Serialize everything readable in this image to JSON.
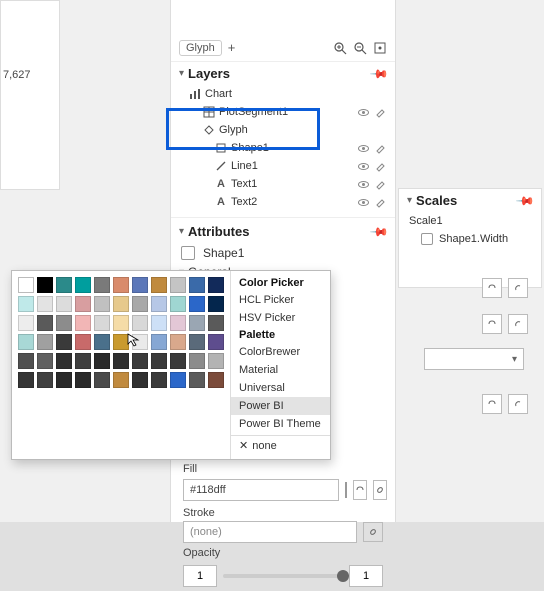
{
  "left_number": "7,627",
  "glyph_tab": "Glyph",
  "layers": {
    "title": "Layers",
    "items": [
      {
        "label": "Chart",
        "icon": "chart-icon"
      },
      {
        "label": "PlotSegment1",
        "icon": "grid-icon"
      },
      {
        "label": "Glyph",
        "icon": "glyph-icon"
      },
      {
        "label": "Shape1",
        "icon": "rect-icon"
      },
      {
        "label": "Line1",
        "icon": "line-icon"
      },
      {
        "label": "Text1",
        "icon": "text-icon"
      },
      {
        "label": "Text2",
        "icon": "text-icon"
      }
    ]
  },
  "attributes": {
    "title": "Attributes",
    "selected": "Shape1",
    "general": "General",
    "fill_label": "Fill",
    "fill_value": "#118dff",
    "fill_color": "#118dff",
    "stroke_label": "Stroke",
    "stroke_value": "(none)",
    "opacity_label": "Opacity",
    "opacity_low": "1",
    "opacity_high": "1"
  },
  "picker": {
    "head1": "Color Picker",
    "hcl": "HCL Picker",
    "hsv": "HSV Picker",
    "head2": "Palette",
    "items": [
      "ColorBrewer",
      "Material",
      "Universal",
      "Power BI",
      "Power BI Theme"
    ],
    "selected": "Power BI",
    "none": "none",
    "colors_row0": [
      "#ffffff",
      "#000000",
      "#2b8a8a",
      "#009e9e",
      "#7a7a7a",
      "#d98b6b",
      "#5b77b9",
      "#c08a3e",
      "#c4c4c4",
      "#3a6aa9",
      "#122a5a"
    ],
    "colors_row1": [
      "#bfe9e9",
      "#e3e3e3",
      "#dcdcdc",
      "#d89ea0",
      "#c0c0c0",
      "#e6c98c",
      "#a8a8a8",
      "#b6c7e6",
      "#9fd6d2",
      "#2b67c9",
      "#04264d"
    ],
    "colors_row2": [
      "#ededed",
      "#5a5a5a",
      "#8c8c8c",
      "#f2b6b6",
      "#d8d8d8",
      "#f5dca7",
      "#d8d8d8",
      "#cde0f7",
      "#e3c7d6",
      "#9aa6b3",
      "#5a5a5a"
    ],
    "colors_row3": [
      "#a8d8d6",
      "#a0a0a0",
      "#3a3a3a",
      "#c86a6a",
      "#4a708b",
      "#c99a2e",
      "#eaeaea",
      "#86a7d4",
      "#d9a88c",
      "#5a6a7a",
      "#5e4d8e"
    ],
    "colors_row4": [
      "#505050",
      "#606060",
      "#2f2f2f",
      "#3f3f3f",
      "#2a2a2a",
      "#2f2f2f",
      "#3a3a3a",
      "#3a3a3a",
      "#3a3a3a",
      "#8c8c8c",
      "#b3b3b3"
    ],
    "colors_row5": [
      "#353535",
      "#404040",
      "#2a2a2a",
      "#2a2a2a",
      "#4a4a4a",
      "#c08a3e",
      "#303030",
      "#3a3a3a",
      "#2b67c9",
      "#5b5b5b",
      "#7b4b3a"
    ]
  },
  "scales": {
    "title": "Scales",
    "item": "Scale1",
    "sub": "Shape1.Width"
  }
}
